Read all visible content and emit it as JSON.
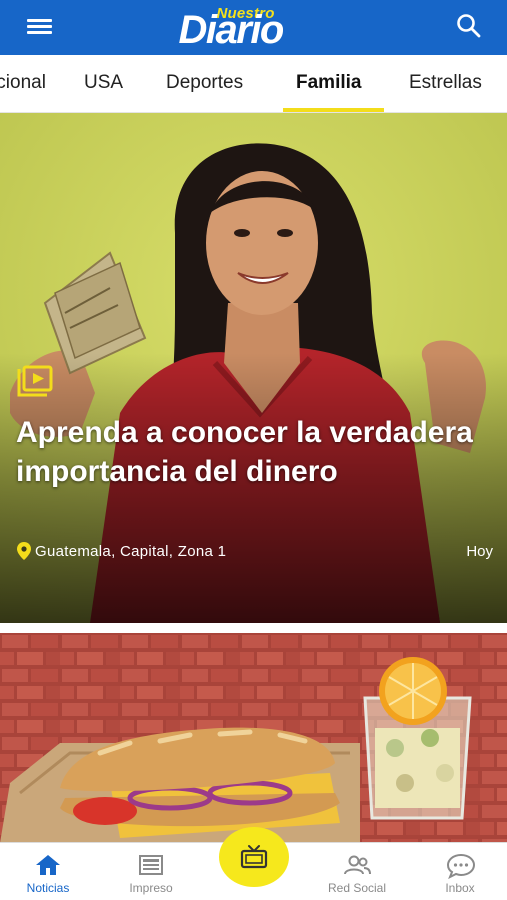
{
  "header": {
    "logo_top": "Nuestro",
    "logo_main": "Diario",
    "menu_icon": "hamburger-menu-icon",
    "search_icon": "search-icon"
  },
  "tabs": [
    {
      "label": "Nacional"
    },
    {
      "label": "USA"
    },
    {
      "label": "Deportes"
    },
    {
      "label": "Familia",
      "active": true
    },
    {
      "label": "Estrellas"
    }
  ],
  "hero": {
    "media_icon": "video-play-icon",
    "title": "Aprenda a conocer la verdadera importancia del dinero",
    "location_icon": "map-pin-icon",
    "location": "Guatemala, Capital, Zona 1",
    "time": "Hoy"
  },
  "bottom_nav": [
    {
      "label": "Noticias",
      "icon": "home-icon",
      "active": true
    },
    {
      "label": "Impreso",
      "icon": "newspaper-icon"
    },
    {
      "label": "",
      "icon": "tv-icon"
    },
    {
      "label": "Red Social",
      "icon": "users-icon"
    },
    {
      "label": "Inbox",
      "icon": "chat-bubble-icon"
    }
  ],
  "colors": {
    "brand_blue": "#1766c8",
    "accent_yellow": "#f3dd1b",
    "active_nav": "#1766c8"
  }
}
